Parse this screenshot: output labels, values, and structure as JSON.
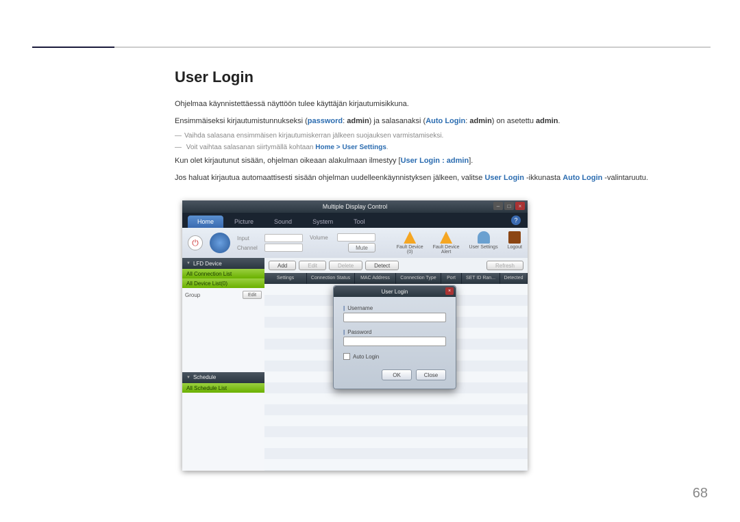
{
  "page": {
    "number": "68"
  },
  "doc": {
    "heading": "User Login",
    "p1": "Ohjelmaa käynnistettäessä näyttöön tulee käyttäjän kirjautumisikkuna.",
    "p2a": "Ensimmäiseksi kirjautumistunnukseksi (",
    "p2_pw": "password",
    "p2b": ": ",
    "p2_admin1": "admin",
    "p2c": ") ja salasanaksi (",
    "p2_auto": "Auto Login",
    "p2d": ": ",
    "p2_admin2": "admin",
    "p2e": ") on asetettu ",
    "p2_admin3": "admin",
    "p2f": ".",
    "note1": "Vaihda salasana ensimmäisen kirjautumiskerran jälkeen suojauksen varmistamiseksi.",
    "note2a": "Voit vaihtaa salasanan siirtymällä kohtaan ",
    "note2_home": "Home",
    "note2_sep": " > ",
    "note2_us": "User Settings",
    "note2b": ".",
    "p3a": "Kun olet kirjautunut sisään, ohjelman oikeaan alakulmaan ilmestyy [",
    "p3_ul": "User Login : admin",
    "p3b": "].",
    "p4a": "Jos haluat kirjautua automaattisesti sisään ohjelman uudelleenkäynnistyksen jälkeen, valitse ",
    "p4_ul": "User Login",
    "p4b": " -ikkunasta ",
    "p4_auto": "Auto Login",
    "p4c": " -valintaruutu."
  },
  "app": {
    "title": "Multiple Display Control",
    "tabs": [
      "Home",
      "Picture",
      "Sound",
      "System",
      "Tool"
    ],
    "toolbar": {
      "input_label": "Input",
      "channel_label": "Channel",
      "volume_label": "Volume",
      "mute": "Mute",
      "actions": [
        {
          "name": "fault-device",
          "label": "Fault Device\n(0)"
        },
        {
          "name": "fault-alert",
          "label": "Fault Device\nAlert"
        },
        {
          "name": "user-settings",
          "label": "User Settings"
        },
        {
          "name": "logout",
          "label": "Logout"
        }
      ]
    },
    "mainbtns": {
      "add": "Add",
      "edit": "Edit",
      "delete": "Delete",
      "detect": "Detect",
      "refresh": "Refresh"
    },
    "cols": [
      "Settings",
      "Connection Status",
      "MAC Address",
      "Connection Type",
      "Port",
      "SET ID Ran...",
      "Detected"
    ],
    "sidebar": {
      "lfd": "LFD Device",
      "allconn": "All Connection List",
      "alldev": "All Device List(0)",
      "group": "Group",
      "edit": "Edit",
      "schedule": "Schedule",
      "allsched": "All Schedule List"
    }
  },
  "dialog": {
    "title": "User Login",
    "username": "Username",
    "password": "Password",
    "auto": "Auto Login",
    "ok": "OK",
    "close": "Close"
  }
}
